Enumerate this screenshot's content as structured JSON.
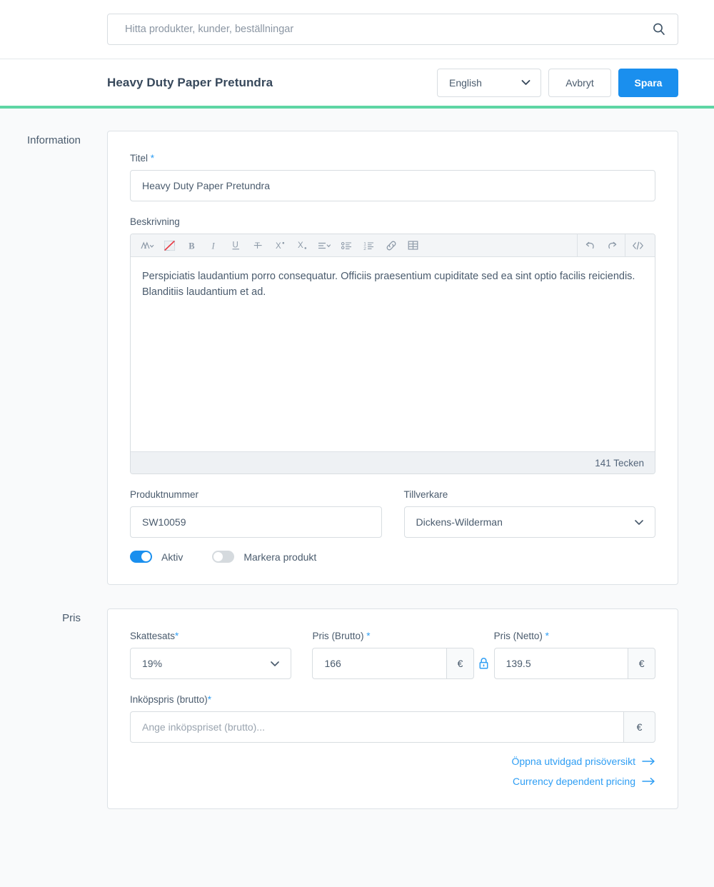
{
  "search": {
    "placeholder": "Hitta produkter, kunder, beställningar",
    "value": "",
    "icon": "search-icon"
  },
  "header": {
    "title": "Heavy Duty Paper Pretundra",
    "language_value": "English",
    "cancel_label": "Avbryt",
    "save_label": "Spara",
    "accent_color": "#5ed6a4",
    "primary_color": "#1a8fee"
  },
  "sections": {
    "information": {
      "label": "Information",
      "title_field": {
        "label": "Titel",
        "required": "*",
        "value": "Heavy Duty Paper Pretundra"
      },
      "description_field": {
        "label": "Beskrivning",
        "content": "Perspiciatis laudantium porro consequatur. Officiis praesentium cupiditate sed ea sint optio facilis reiciendis. Blanditiis laudantium et ad.",
        "char_count": "141 Tecken",
        "toolbar": [
          {
            "name": "font-style-icon",
            "glyph": "A"
          },
          {
            "name": "clear-formatting-icon",
            "glyph": ""
          },
          {
            "name": "bold-icon",
            "glyph": "B"
          },
          {
            "name": "italic-icon",
            "glyph": "I"
          },
          {
            "name": "underline-icon",
            "glyph": "U"
          },
          {
            "name": "strikethrough-icon",
            "glyph": "S"
          },
          {
            "name": "superscript-icon",
            "glyph": "X"
          },
          {
            "name": "subscript-icon",
            "glyph": "X"
          },
          {
            "name": "text-align-icon",
            "glyph": ""
          },
          {
            "name": "bullet-list-icon",
            "glyph": ""
          },
          {
            "name": "numbered-list-icon",
            "glyph": ""
          },
          {
            "name": "link-icon",
            "glyph": ""
          },
          {
            "name": "table-icon",
            "glyph": ""
          }
        ],
        "toolbar_right": [
          {
            "name": "undo-icon"
          },
          {
            "name": "redo-icon"
          },
          {
            "name": "source-code-icon"
          }
        ]
      },
      "product_number_field": {
        "label": "Produktnummer",
        "value": "SW10059"
      },
      "manufacturer_field": {
        "label": "Tillverkare",
        "value": "Dickens-Wilderman"
      },
      "toggles": [
        {
          "label": "Aktiv",
          "state": "on"
        },
        {
          "label": "Markera produkt",
          "state": "off"
        }
      ]
    },
    "price": {
      "label": "Pris",
      "tax_rate_field": {
        "label": "Skattesats",
        "required": "*",
        "value": "19%"
      },
      "gross_price_field": {
        "label": "Pris (Brutto)",
        "required": "*",
        "value": "166",
        "unit": "€"
      },
      "net_price_field": {
        "label": "Pris (Netto)",
        "required": "*",
        "value": "139.5",
        "unit": "€"
      },
      "lock_icon": "lock-closed-icon",
      "purchase_price_field": {
        "label": "Inköpspris (brutto)",
        "required": "*",
        "placeholder": "Ange inköpspriset (brutto)...",
        "value": "",
        "unit": "€"
      },
      "links": [
        {
          "label": "Öppna utvidgad prisöversikt",
          "icon": "arrow-right-icon"
        },
        {
          "label": "Currency dependent pricing",
          "icon": "arrow-right-icon"
        }
      ]
    }
  }
}
